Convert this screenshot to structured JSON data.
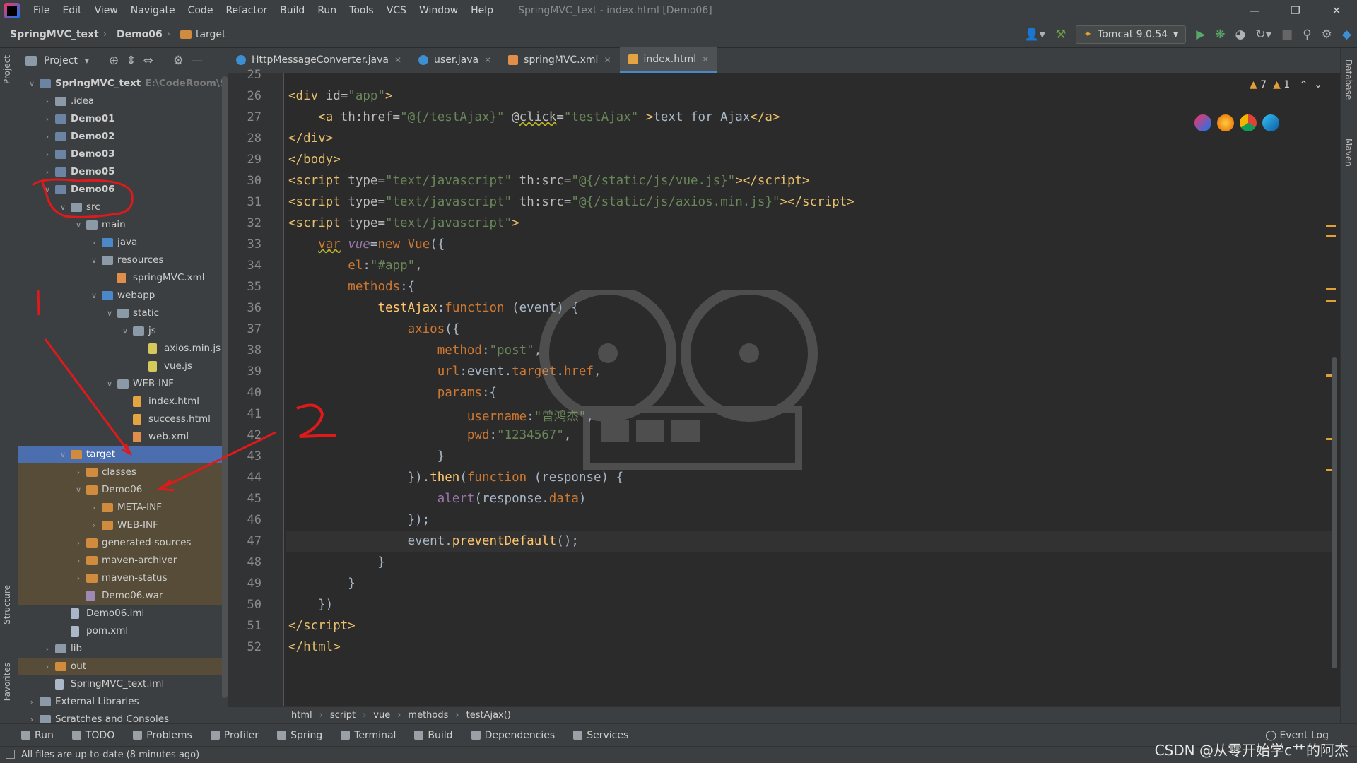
{
  "menu": {
    "items": [
      "File",
      "Edit",
      "View",
      "Navigate",
      "Code",
      "Refactor",
      "Build",
      "Run",
      "Tools",
      "VCS",
      "Window",
      "Help"
    ],
    "window_title": "SpringMVC_text - index.html [Demo06]"
  },
  "navbar": {
    "breadcrumb": [
      "SpringMVC_text",
      "Demo06",
      "target"
    ],
    "run_config": "Tomcat 9.0.54"
  },
  "project_panel": {
    "title": "Project",
    "root_path": "E:\\CodeRoom\\Spring",
    "tree": [
      {
        "label": "SpringMVC_text",
        "depth": 0,
        "arrow": "open",
        "icon": "mod",
        "bold": true
      },
      {
        "label": ".idea",
        "depth": 1,
        "arrow": "closed",
        "icon": "folder"
      },
      {
        "label": "Demo01",
        "depth": 1,
        "arrow": "closed",
        "icon": "mod",
        "bold": true
      },
      {
        "label": "Demo02",
        "depth": 1,
        "arrow": "closed",
        "icon": "mod",
        "bold": true
      },
      {
        "label": "Demo03",
        "depth": 1,
        "arrow": "closed",
        "icon": "mod",
        "bold": true
      },
      {
        "label": "Demo05",
        "depth": 1,
        "arrow": "closed",
        "icon": "mod",
        "bold": true
      },
      {
        "label": "Demo06",
        "depth": 1,
        "arrow": "open",
        "icon": "mod",
        "bold": true
      },
      {
        "label": "src",
        "depth": 2,
        "arrow": "open",
        "icon": "folder"
      },
      {
        "label": "main",
        "depth": 3,
        "arrow": "open",
        "icon": "folder"
      },
      {
        "label": "java",
        "depth": 4,
        "arrow": "closed",
        "icon": "blue"
      },
      {
        "label": "resources",
        "depth": 4,
        "arrow": "open",
        "icon": "folder"
      },
      {
        "label": "springMVC.xml",
        "depth": 5,
        "arrow": "",
        "icon": "xml"
      },
      {
        "label": "webapp",
        "depth": 4,
        "arrow": "open",
        "icon": "blue"
      },
      {
        "label": "static",
        "depth": 5,
        "arrow": "open",
        "icon": "folder"
      },
      {
        "label": "js",
        "depth": 6,
        "arrow": "open",
        "icon": "folder"
      },
      {
        "label": "axios.min.js",
        "depth": 7,
        "arrow": "",
        "icon": "js"
      },
      {
        "label": "vue.js",
        "depth": 7,
        "arrow": "",
        "icon": "js"
      },
      {
        "label": "WEB-INF",
        "depth": 5,
        "arrow": "open",
        "icon": "folder"
      },
      {
        "label": "index.html",
        "depth": 6,
        "arrow": "",
        "icon": "html"
      },
      {
        "label": "success.html",
        "depth": 6,
        "arrow": "",
        "icon": "html"
      },
      {
        "label": "web.xml",
        "depth": 6,
        "arrow": "",
        "icon": "xml"
      },
      {
        "label": "target",
        "depth": 2,
        "arrow": "open",
        "icon": "orange",
        "state": "sel"
      },
      {
        "label": "classes",
        "depth": 3,
        "arrow": "closed",
        "icon": "orange",
        "state": "ex"
      },
      {
        "label": "Demo06",
        "depth": 3,
        "arrow": "open",
        "icon": "orange",
        "state": "ex"
      },
      {
        "label": "META-INF",
        "depth": 4,
        "arrow": "closed",
        "icon": "orange",
        "state": "ex"
      },
      {
        "label": "WEB-INF",
        "depth": 4,
        "arrow": "closed",
        "icon": "orange",
        "state": "ex"
      },
      {
        "label": "generated-sources",
        "depth": 3,
        "arrow": "closed",
        "icon": "orange",
        "state": "ex"
      },
      {
        "label": "maven-archiver",
        "depth": 3,
        "arrow": "closed",
        "icon": "orange",
        "state": "ex"
      },
      {
        "label": "maven-status",
        "depth": 3,
        "arrow": "closed",
        "icon": "orange",
        "state": "ex"
      },
      {
        "label": "Demo06.war",
        "depth": 3,
        "arrow": "",
        "icon": "war",
        "state": "ex"
      },
      {
        "label": "Demo06.iml",
        "depth": 2,
        "arrow": "",
        "icon": "file"
      },
      {
        "label": "pom.xml",
        "depth": 2,
        "arrow": "",
        "icon": "file"
      },
      {
        "label": "lib",
        "depth": 1,
        "arrow": "closed",
        "icon": "folder"
      },
      {
        "label": "out",
        "depth": 1,
        "arrow": "closed",
        "icon": "orange",
        "state": "ex"
      },
      {
        "label": "SpringMVC_text.iml",
        "depth": 1,
        "arrow": "",
        "icon": "file"
      },
      {
        "label": "External Libraries",
        "depth": 0,
        "arrow": "closed",
        "icon": "folder"
      },
      {
        "label": "Scratches and Consoles",
        "depth": 0,
        "arrow": "closed",
        "icon": "folder"
      }
    ]
  },
  "editor": {
    "tabs": [
      {
        "label": "HttpMessageConverter.java",
        "icon": "java"
      },
      {
        "label": "user.java",
        "icon": "java"
      },
      {
        "label": "springMVC.xml",
        "icon": "xml"
      },
      {
        "label": "index.html",
        "icon": "html",
        "active": true
      }
    ],
    "warnings": {
      "warn_count": "7",
      "weak_count": "1"
    },
    "current_line": 47,
    "lines": [
      {
        "n": 25,
        "html": ""
      },
      {
        "n": 26,
        "html": "<span class='tag'>&lt;div </span><span class='attr'>id=</span><span class='str'>\"app\"</span><span class='tag'>&gt;</span>"
      },
      {
        "n": 27,
        "html": "    <span class='tag'>&lt;a </span><span class='attr'>th:href=</span><span class='str'>\"@{/testAjax}\"</span> <span class='attr u'>@click</span><span class='attr'>=</span><span class='str'>\"testAjax\"</span> <span class='tag'>&gt;</span>text for Ajax<span class='tag'>&lt;/a&gt;</span>"
      },
      {
        "n": 28,
        "html": "<span class='tag'>&lt;/div&gt;</span>"
      },
      {
        "n": 29,
        "html": "<span class='tag'>&lt;/body&gt;</span>"
      },
      {
        "n": 30,
        "html": "<span class='tag'>&lt;script </span><span class='attr'>type=</span><span class='str'>\"text/javascript\"</span> <span class='attr'>th:src=</span><span class='str'>\"@{/static/js/vue.js}\"</span><span class='tag'>&gt;&lt;/script&gt;</span>"
      },
      {
        "n": 31,
        "html": "<span class='tag'>&lt;script </span><span class='attr'>type=</span><span class='str'>\"text/javascript\"</span> <span class='attr'>th:src=</span><span class='str'>\"@{/static/js/axios.min.js}\"</span><span class='tag'>&gt;&lt;/script&gt;</span>"
      },
      {
        "n": 32,
        "html": "<span class='tag'>&lt;script </span><span class='attr'>type=</span><span class='str'>\"text/javascript\"</span><span class='tag'>&gt;</span>"
      },
      {
        "n": 33,
        "html": "    <span class='kw u'>var</span> <span class='prop'><i>vue</i></span>=<span class='kw'>new</span> <span class='kw'>Vue</span>({"
      },
      {
        "n": 34,
        "html": "        <span class='kw'>el</span>:<span class='str'>\"#app\"</span>,"
      },
      {
        "n": 35,
        "html": "        <span class='kw'>methods</span>:{"
      },
      {
        "n": 36,
        "html": "            <span class='method'>testAjax</span>:<span class='kw'>function</span> (event) {"
      },
      {
        "n": 37,
        "html": "                <span class='kw'>axios</span>({"
      },
      {
        "n": 38,
        "html": "                    <span class='kw'>method</span>:<span class='str'>\"post\"</span>,"
      },
      {
        "n": 39,
        "html": "                    <span class='kw'>url</span>:event.<span class='kw'>target</span>.<span class='kw'>href</span>,"
      },
      {
        "n": 40,
        "html": "                    <span class='kw'>params</span>:{"
      },
      {
        "n": 41,
        "html": "                        <span class='kw'>username</span>:<span class='str'>\"曾鸿杰\"</span>,"
      },
      {
        "n": 42,
        "html": "                        <span class='kw'>pwd</span>:<span class='str'>\"1234567\"</span>,"
      },
      {
        "n": 43,
        "html": "                    }"
      },
      {
        "n": 44,
        "html": "                }).<span class='method'>then</span>(<span class='kw'>function</span> (response) {"
      },
      {
        "n": 45,
        "html": "                    <span class='prop'>alert</span>(response.<span class='kw'>data</span>)"
      },
      {
        "n": 46,
        "html": "                });"
      },
      {
        "n": 47,
        "html": "                event.<span class='method'>preventDefault</span>();"
      },
      {
        "n": 48,
        "html": "            }"
      },
      {
        "n": 49,
        "html": "        }"
      },
      {
        "n": 50,
        "html": "    })"
      },
      {
        "n": 51,
        "html": "<span class='tag'>&lt;/script&gt;</span>"
      },
      {
        "n": 52,
        "html": "<span class='tag'>&lt;/html&gt;</span>"
      }
    ],
    "breadcrumbs": [
      "html",
      "script",
      "vue",
      "methods",
      "testAjax()"
    ]
  },
  "side_labels": {
    "left_top": "Project",
    "left_structure": "Structure",
    "left_favorites": "Favorites",
    "right_db": "Database",
    "right_maven": "Maven"
  },
  "tool_windows": [
    "Run",
    "TODO",
    "Problems",
    "Profiler",
    "Spring",
    "Terminal",
    "Build",
    "Dependencies",
    "Services"
  ],
  "event_log": "Event Log",
  "status": {
    "message": "All files are up-to-date (8 minutes ago)"
  },
  "watermark": "CSDN @从零开始学c艹的阿杰",
  "colors": {
    "selection": "#4b6eaf",
    "excluded": "#574c37",
    "annotation_red": "#e0191b"
  }
}
